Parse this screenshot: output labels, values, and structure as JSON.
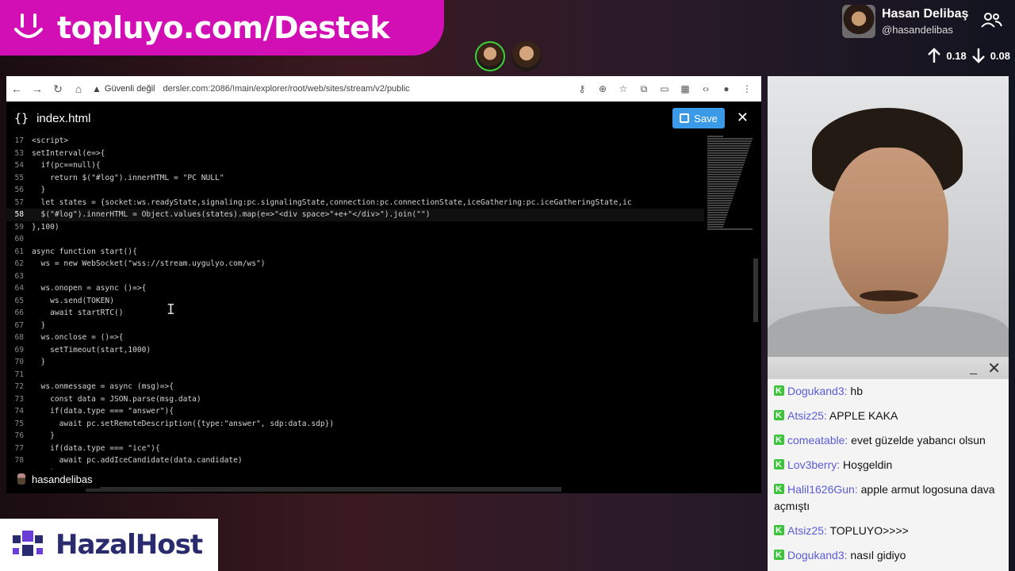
{
  "banner": {
    "text": "topluyo.com/Destek"
  },
  "streamer": {
    "name": "Hasan Delibaş",
    "handle": "@hasandelibas"
  },
  "network": {
    "up": "0.18",
    "down": "0.08"
  },
  "browser": {
    "insecure_label": "Güvenli değil",
    "url": "dersler.com:2086/!main/explorer/root/web/sites/stream/v2/public"
  },
  "editor": {
    "file_name": "index.html",
    "save_label": "Save",
    "lines": [
      {
        "n": "17",
        "t": "<script>"
      },
      {
        "n": "53",
        "t": "setInterval(e=>{"
      },
      {
        "n": "54",
        "t": "  if(pc==null){"
      },
      {
        "n": "55",
        "t": "    return $(\"#log\").innerHTML = \"PC NULL\""
      },
      {
        "n": "56",
        "t": "  }"
      },
      {
        "n": "57",
        "t": "  let states = {socket:ws.readyState,signaling:pc.signalingState,connection:pc.connectionState,iceGathering:pc.iceGatheringState,ic"
      },
      {
        "n": "58",
        "t": "  $(\"#log\").innerHTML = Object.values(states).map(e=>\"<div space>\"+e+\"</div>\").join(\"\")"
      },
      {
        "n": "59",
        "t": "},100)"
      },
      {
        "n": "60",
        "t": ""
      },
      {
        "n": "61",
        "t": "async function start(){"
      },
      {
        "n": "62",
        "t": "  ws = new WebSocket(\"wss://stream.uygulyo.com/ws\")"
      },
      {
        "n": "63",
        "t": ""
      },
      {
        "n": "64",
        "t": "  ws.onopen = async ()=>{"
      },
      {
        "n": "65",
        "t": "    ws.send(TOKEN)"
      },
      {
        "n": "66",
        "t": "    await startRTC()"
      },
      {
        "n": "67",
        "t": "  }"
      },
      {
        "n": "68",
        "t": "  ws.onclose = ()=>{"
      },
      {
        "n": "69",
        "t": "    setTimeout(start,1000)"
      },
      {
        "n": "70",
        "t": "  }"
      },
      {
        "n": "71",
        "t": ""
      },
      {
        "n": "72",
        "t": "  ws.onmessage = async (msg)=>{"
      },
      {
        "n": "73",
        "t": "    const data = JSON.parse(msg.data)"
      },
      {
        "n": "74",
        "t": "    if(data.type === \"answer\"){"
      },
      {
        "n": "75",
        "t": "      await pc.setRemoteDescription({type:\"answer\", sdp:data.sdp})"
      },
      {
        "n": "76",
        "t": "    }"
      },
      {
        "n": "77",
        "t": "    if(data.type === \"ice\"){"
      },
      {
        "n": "78",
        "t": "      await pc.addIceCandidate(data.candidate)"
      },
      {
        "n": "79",
        "t": "    }"
      }
    ]
  },
  "user_tag": {
    "name": "hasandelibas"
  },
  "chat": {
    "messages": [
      {
        "user": "Dogukand3:",
        "text": " hb"
      },
      {
        "user": "Atsiz25:",
        "text": " APPLE KAKA"
      },
      {
        "user": "comeatable:",
        "text": " evet güzelde yabancı olsun"
      },
      {
        "user": "Lov3berry:",
        "text": " Hoşgeldin"
      },
      {
        "user": "Halil1626Gun:",
        "text": " apple armut logosuna dava açmıştı"
      },
      {
        "user": "Atsiz25:",
        "text": " TOPLUYO>>>>"
      },
      {
        "user": "Dogukand3:",
        "text": " nasıl gidiyo"
      }
    ]
  },
  "logo": {
    "text": "HazalHost"
  },
  "colors": {
    "banner": "#d10fb4",
    "save": "#3b9ae8",
    "chat_user": "#5b5bd8",
    "kick_badge": "#3bc33b"
  }
}
